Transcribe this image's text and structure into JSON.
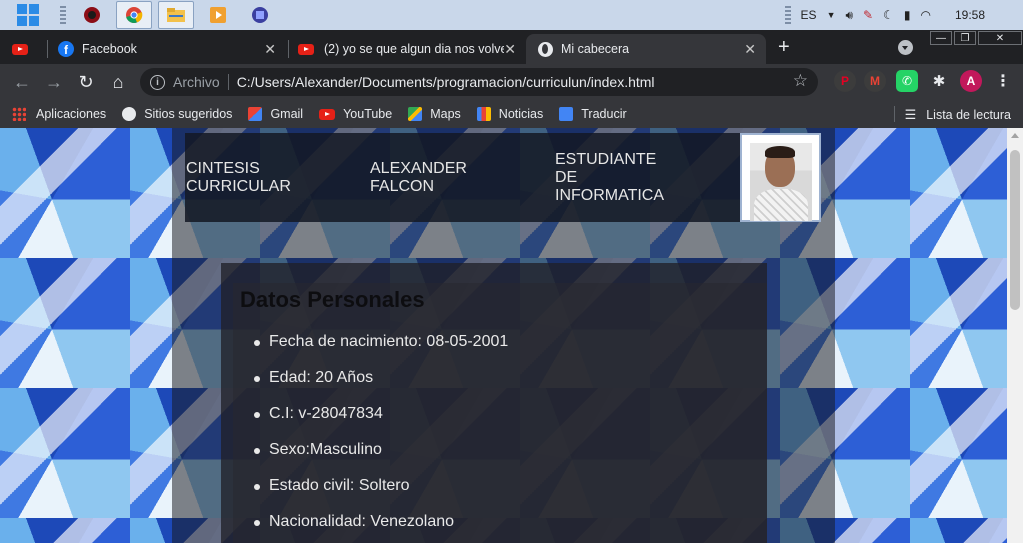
{
  "taskbar": {
    "language": "ES",
    "clock": "19:58"
  },
  "tabs": [
    {
      "title": "",
      "icon": "youtube-icon"
    },
    {
      "title": "Facebook",
      "icon": "facebook-icon"
    },
    {
      "title": "(2) yo se que algun dia nos volve",
      "icon": "youtube-icon"
    },
    {
      "title": "Mi cabecera",
      "icon": "globe-icon",
      "active": true
    }
  ],
  "toolbar": {
    "scheme_label": "Archivo",
    "url": "C:/Users/Alexander/Documents/programacion/curriculun/index.html",
    "profile_initial": "A"
  },
  "bookmarks": {
    "items": [
      "Aplicaciones",
      "Sitios sugeridos",
      "Gmail",
      "YouTube",
      "Maps",
      "Noticias",
      "Traducir"
    ],
    "reading_list": "Lista de lectura"
  },
  "page": {
    "header": {
      "col1": "CINTESIS CURRICULAR",
      "col2": "ALEXANDER FALCON",
      "col3": "ESTUDIANTE DE INFORMATICA"
    },
    "section_title": "Datos Personales",
    "personal_data": [
      "Fecha de nacimiento: 08-05-2001",
      "Edad: 20 Años",
      "C.I: v-28047834",
      "Sexo:Masculino",
      "Estado civil: Soltero",
      "Nacionalidad: Venezolano"
    ]
  },
  "colors": {
    "chrome_dark": "#202124",
    "chrome_toolbar": "#35363a",
    "taskbar": "#c9d7ea",
    "page_pattern_blue": "#2d5fd6"
  }
}
